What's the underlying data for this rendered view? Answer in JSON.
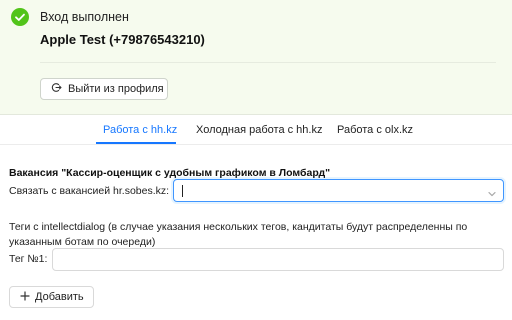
{
  "auth": {
    "status": "Вход выполнен",
    "user": "Apple Test (+79876543210)",
    "logout_label": "Выйти из профиля",
    "success_color": "#52c41a"
  },
  "tabs": [
    {
      "label": "Работа с hh.kz",
      "active": true
    },
    {
      "label": "Холодная работа с hh.kz",
      "active": false
    },
    {
      "label": "Работа с olx.kz",
      "active": false
    }
  ],
  "form": {
    "vacancy_title": "Вакансия \"Кассир-оценщик с удобным графиком в Ломбард\"",
    "link_label": "Связать с вакансией hr.sobes.kz",
    "link_value": "",
    "tags_description": "Теги с intellectdialog (в случае указания нескольких тегов, кандитаты будут распределенны по указанным ботам по очереди)",
    "tag_label": "Тег №1",
    "tag_value": "",
    "add_label": "Добавить"
  },
  "accent_color": "#1677ff",
  "icons": {
    "status": "check-circle-icon",
    "logout": "logout-icon",
    "select": "chevron-down-icon",
    "add": "plus-icon"
  }
}
